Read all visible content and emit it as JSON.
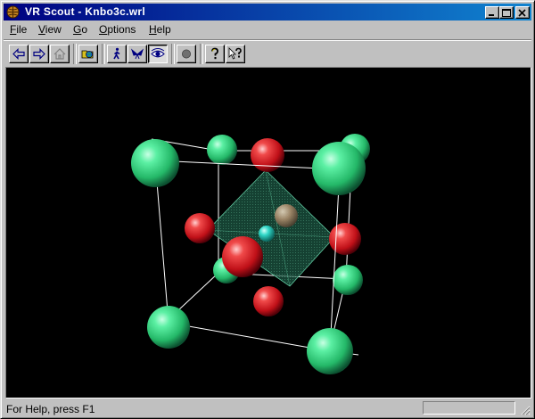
{
  "window": {
    "title": "VR Scout - Knbo3c.wrl"
  },
  "menu": [
    {
      "label": "File",
      "mnemonic": "F",
      "rest": "ile"
    },
    {
      "label": "View",
      "mnemonic": "V",
      "rest": "iew"
    },
    {
      "label": "Go",
      "mnemonic": "G",
      "rest": "o"
    },
    {
      "label": "Options",
      "mnemonic": "O",
      "rest": "ptions"
    },
    {
      "label": "Help",
      "mnemonic": "H",
      "rest": "elp"
    }
  ],
  "toolbar": {
    "buttons": [
      {
        "name": "back",
        "icon": "arrow-left-icon",
        "state": "disabled"
      },
      {
        "name": "forward",
        "icon": "arrow-right-icon",
        "state": "disabled"
      },
      {
        "name": "home",
        "icon": "home-icon",
        "state": "disabled"
      },
      {
        "name": "open",
        "icon": "open-world-icon",
        "state": "normal"
      },
      {
        "name": "walk",
        "icon": "walk-icon",
        "state": "normal"
      },
      {
        "name": "fly",
        "icon": "fly-icon",
        "state": "normal"
      },
      {
        "name": "examine",
        "icon": "eye-icon",
        "state": "pressed"
      },
      {
        "name": "stop",
        "icon": "stop-icon",
        "state": "disabled"
      },
      {
        "name": "help",
        "icon": "help-icon",
        "state": "normal"
      },
      {
        "name": "context-help",
        "icon": "context-help-icon",
        "state": "normal"
      }
    ]
  },
  "scene": {
    "background": "#000000",
    "atom_colors": {
      "green": "#3ee08a",
      "red": "#e0202a",
      "cyan": "#2fd8c8",
      "tan": "#b89a78"
    },
    "octahedron_color": "#2a7a5a",
    "edge_color": "#ffffff"
  },
  "status": {
    "text": "For Help, press F1"
  }
}
